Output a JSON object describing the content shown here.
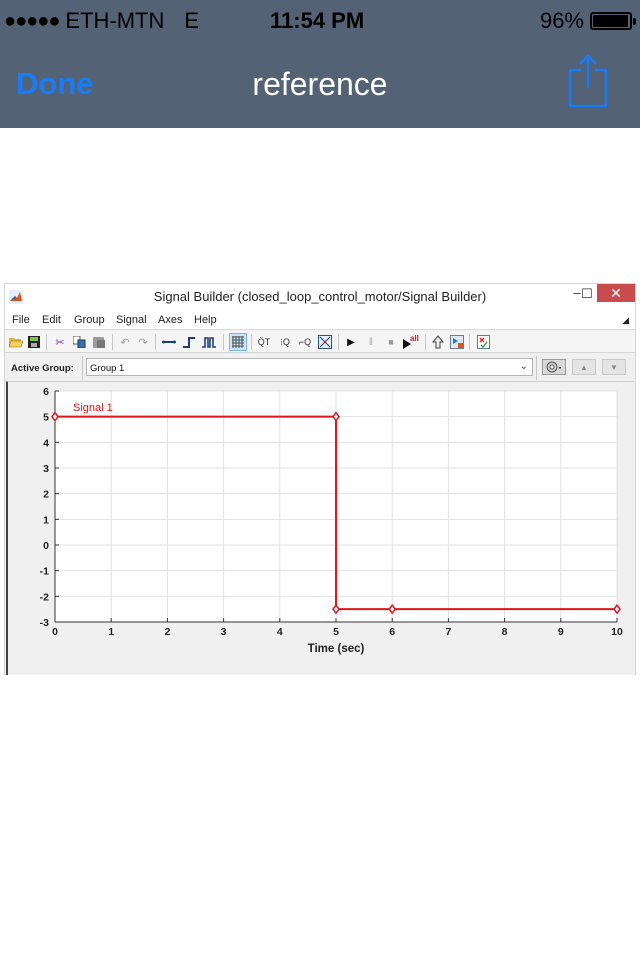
{
  "status_bar": {
    "signal_dots": "●●●●●",
    "carrier": "ETH-MTN",
    "network": "E",
    "time": "11:54 PM",
    "battery": "96%",
    "battery_level": 0.96
  },
  "nav": {
    "done_label": "Done",
    "title": "reference",
    "share_icon": "share-icon"
  },
  "window": {
    "title": "Signal Builder (closed_loop_control_motor/Signal Builder)",
    "controls": {
      "minimize": "–",
      "maximize": "☐",
      "close": "✕"
    },
    "menu": [
      "File",
      "Edit",
      "Group",
      "Signal",
      "Axes",
      "Help"
    ],
    "toolbar_icons": [
      "open-icon",
      "save-icon",
      "cut-icon",
      "copy-icon",
      "paste-icon",
      "undo-icon",
      "redo-icon",
      "line-icon",
      "step-icon",
      "pulse-icon",
      "grid-icon",
      "zoom-x-icon",
      "zoom-y-icon",
      "zoom-xy-icon",
      "fit-icon",
      "play-icon",
      "pause-icon",
      "stop-icon",
      "run-all-icon",
      "up-icon",
      "export-icon",
      "verify-icon"
    ],
    "active_group_label": "Active Group:",
    "active_group_value": "Group 1",
    "accent_color": "#e0141a"
  },
  "chart_data": {
    "type": "line",
    "title": "",
    "series": [
      {
        "name": "Signal 1",
        "color": "#e0141a",
        "x": [
          0,
          5,
          5,
          6,
          10
        ],
        "y": [
          5,
          5,
          -2.5,
          -2.5,
          -2.5
        ]
      }
    ],
    "xlabel": "Time (sec)",
    "ylabel": "",
    "xlim": [
      0,
      10
    ],
    "ylim": [
      -3,
      6
    ],
    "xticks": [
      "0",
      "1",
      "2",
      "3",
      "4",
      "5",
      "6",
      "7",
      "8",
      "9",
      "10"
    ],
    "yticks": [
      "-3",
      "-2",
      "-1",
      "0",
      "1",
      "2",
      "3",
      "4",
      "5",
      "6"
    ],
    "grid": true,
    "legend": "top-left"
  }
}
